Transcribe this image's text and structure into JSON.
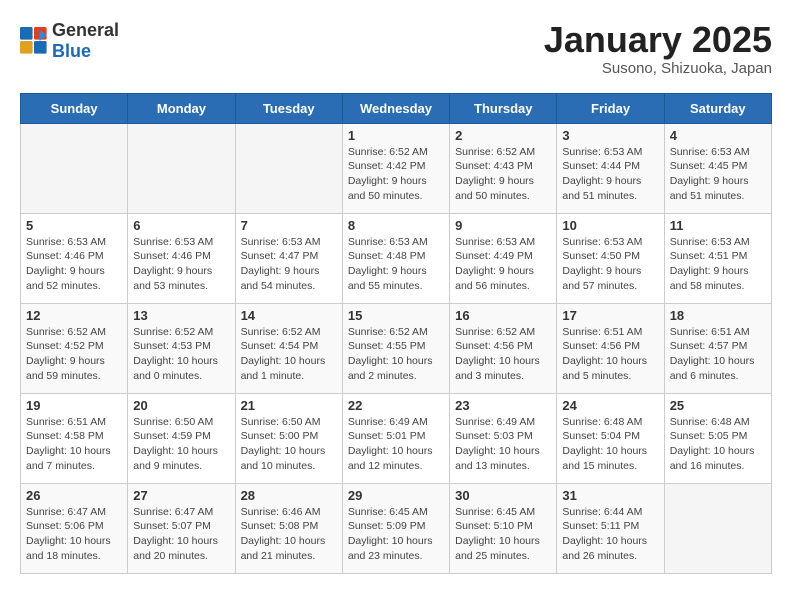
{
  "header": {
    "logo_general": "General",
    "logo_blue": "Blue",
    "title": "January 2025",
    "subtitle": "Susono, Shizuoka, Japan"
  },
  "days_of_week": [
    "Sunday",
    "Monday",
    "Tuesday",
    "Wednesday",
    "Thursday",
    "Friday",
    "Saturday"
  ],
  "weeks": [
    [
      {
        "day": "",
        "info": ""
      },
      {
        "day": "",
        "info": ""
      },
      {
        "day": "",
        "info": ""
      },
      {
        "day": "1",
        "info": "Sunrise: 6:52 AM\nSunset: 4:42 PM\nDaylight: 9 hours\nand 50 minutes."
      },
      {
        "day": "2",
        "info": "Sunrise: 6:52 AM\nSunset: 4:43 PM\nDaylight: 9 hours\nand 50 minutes."
      },
      {
        "day": "3",
        "info": "Sunrise: 6:53 AM\nSunset: 4:44 PM\nDaylight: 9 hours\nand 51 minutes."
      },
      {
        "day": "4",
        "info": "Sunrise: 6:53 AM\nSunset: 4:45 PM\nDaylight: 9 hours\nand 51 minutes."
      }
    ],
    [
      {
        "day": "5",
        "info": "Sunrise: 6:53 AM\nSunset: 4:46 PM\nDaylight: 9 hours\nand 52 minutes."
      },
      {
        "day": "6",
        "info": "Sunrise: 6:53 AM\nSunset: 4:46 PM\nDaylight: 9 hours\nand 53 minutes."
      },
      {
        "day": "7",
        "info": "Sunrise: 6:53 AM\nSunset: 4:47 PM\nDaylight: 9 hours\nand 54 minutes."
      },
      {
        "day": "8",
        "info": "Sunrise: 6:53 AM\nSunset: 4:48 PM\nDaylight: 9 hours\nand 55 minutes."
      },
      {
        "day": "9",
        "info": "Sunrise: 6:53 AM\nSunset: 4:49 PM\nDaylight: 9 hours\nand 56 minutes."
      },
      {
        "day": "10",
        "info": "Sunrise: 6:53 AM\nSunset: 4:50 PM\nDaylight: 9 hours\nand 57 minutes."
      },
      {
        "day": "11",
        "info": "Sunrise: 6:53 AM\nSunset: 4:51 PM\nDaylight: 9 hours\nand 58 minutes."
      }
    ],
    [
      {
        "day": "12",
        "info": "Sunrise: 6:52 AM\nSunset: 4:52 PM\nDaylight: 9 hours\nand 59 minutes."
      },
      {
        "day": "13",
        "info": "Sunrise: 6:52 AM\nSunset: 4:53 PM\nDaylight: 10 hours\nand 0 minutes."
      },
      {
        "day": "14",
        "info": "Sunrise: 6:52 AM\nSunset: 4:54 PM\nDaylight: 10 hours\nand 1 minute."
      },
      {
        "day": "15",
        "info": "Sunrise: 6:52 AM\nSunset: 4:55 PM\nDaylight: 10 hours\nand 2 minutes."
      },
      {
        "day": "16",
        "info": "Sunrise: 6:52 AM\nSunset: 4:56 PM\nDaylight: 10 hours\nand 3 minutes."
      },
      {
        "day": "17",
        "info": "Sunrise: 6:51 AM\nSunset: 4:56 PM\nDaylight: 10 hours\nand 5 minutes."
      },
      {
        "day": "18",
        "info": "Sunrise: 6:51 AM\nSunset: 4:57 PM\nDaylight: 10 hours\nand 6 minutes."
      }
    ],
    [
      {
        "day": "19",
        "info": "Sunrise: 6:51 AM\nSunset: 4:58 PM\nDaylight: 10 hours\nand 7 minutes."
      },
      {
        "day": "20",
        "info": "Sunrise: 6:50 AM\nSunset: 4:59 PM\nDaylight: 10 hours\nand 9 minutes."
      },
      {
        "day": "21",
        "info": "Sunrise: 6:50 AM\nSunset: 5:00 PM\nDaylight: 10 hours\nand 10 minutes."
      },
      {
        "day": "22",
        "info": "Sunrise: 6:49 AM\nSunset: 5:01 PM\nDaylight: 10 hours\nand 12 minutes."
      },
      {
        "day": "23",
        "info": "Sunrise: 6:49 AM\nSunset: 5:03 PM\nDaylight: 10 hours\nand 13 minutes."
      },
      {
        "day": "24",
        "info": "Sunrise: 6:48 AM\nSunset: 5:04 PM\nDaylight: 10 hours\nand 15 minutes."
      },
      {
        "day": "25",
        "info": "Sunrise: 6:48 AM\nSunset: 5:05 PM\nDaylight: 10 hours\nand 16 minutes."
      }
    ],
    [
      {
        "day": "26",
        "info": "Sunrise: 6:47 AM\nSunset: 5:06 PM\nDaylight: 10 hours\nand 18 minutes."
      },
      {
        "day": "27",
        "info": "Sunrise: 6:47 AM\nSunset: 5:07 PM\nDaylight: 10 hours\nand 20 minutes."
      },
      {
        "day": "28",
        "info": "Sunrise: 6:46 AM\nSunset: 5:08 PM\nDaylight: 10 hours\nand 21 minutes."
      },
      {
        "day": "29",
        "info": "Sunrise: 6:45 AM\nSunset: 5:09 PM\nDaylight: 10 hours\nand 23 minutes."
      },
      {
        "day": "30",
        "info": "Sunrise: 6:45 AM\nSunset: 5:10 PM\nDaylight: 10 hours\nand 25 minutes."
      },
      {
        "day": "31",
        "info": "Sunrise: 6:44 AM\nSunset: 5:11 PM\nDaylight: 10 hours\nand 26 minutes."
      },
      {
        "day": "",
        "info": ""
      }
    ]
  ]
}
